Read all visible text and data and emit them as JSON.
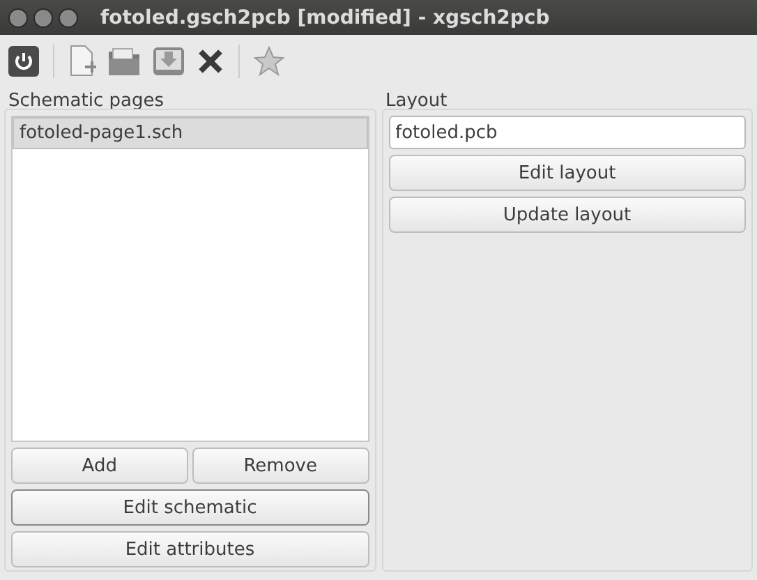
{
  "window": {
    "title": "fotoled.gsch2pcb [modified] - xgsch2pcb"
  },
  "toolbar": [
    {
      "kind": "power"
    },
    {
      "kind": "sep"
    },
    {
      "kind": "new"
    },
    {
      "kind": "open"
    },
    {
      "kind": "save"
    },
    {
      "kind": "delete"
    },
    {
      "kind": "sep"
    },
    {
      "kind": "star"
    }
  ],
  "schematic_pages": {
    "title": "Schematic pages",
    "items": [
      {
        "label": "fotoled-page1.sch",
        "selected": true
      }
    ],
    "buttons": [
      {
        "label": "Add",
        "focused": false
      },
      {
        "label": "Remove",
        "focused": false
      }
    ],
    "actions": [
      {
        "label": "Edit schematic",
        "focused": true
      },
      {
        "label": "Edit attributes",
        "focused": false
      }
    ]
  },
  "layout": {
    "title": "Layout",
    "value": "fotoled.pcb",
    "buttons": [
      {
        "label": "Edit layout",
        "focused": false
      },
      {
        "label": "Update layout",
        "focused": false
      }
    ]
  }
}
